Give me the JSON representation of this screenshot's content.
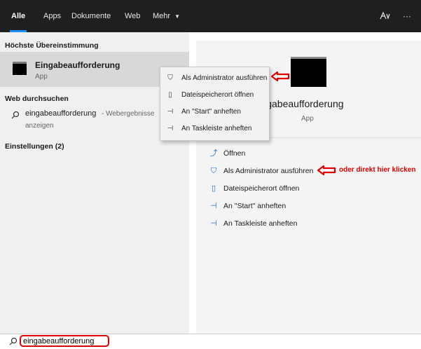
{
  "tabs": [
    {
      "label": "Alle"
    },
    {
      "label": "Apps"
    },
    {
      "label": "Dokumente"
    },
    {
      "label": "Web"
    },
    {
      "label": "Mehr"
    }
  ],
  "top_actions": {
    "more": "···"
  },
  "left": {
    "best_match_header": "Höchste Übereinstimmung",
    "best_match": {
      "title": "Eingabeaufforderung",
      "subtitle": "App"
    },
    "web_header": "Web durchsuchen",
    "web_result": {
      "query": "eingabeaufforderung",
      "suffix": "- Webergebnisse",
      "suffix2": "anzeigen"
    },
    "settings_header": "Einstellungen (2)"
  },
  "right": {
    "app_title": "Eingabeaufforderung",
    "app_subtitle": "App",
    "actions": [
      {
        "label": "Öffnen",
        "icon": "open-icon"
      },
      {
        "label": "Als Administrator ausführen",
        "icon": "admin-shield-icon"
      },
      {
        "label": "Dateispeicherort öffnen",
        "icon": "file-location-icon"
      },
      {
        "label": "An \"Start\" anheften",
        "icon": "pin-icon"
      },
      {
        "label": "An Taskleiste anheften",
        "icon": "pin-icon"
      }
    ]
  },
  "context_menu": [
    {
      "label": "Als Administrator ausführen",
      "icon": "admin-shield-icon"
    },
    {
      "label": "Dateispeicherort öffnen",
      "icon": "file-location-icon"
    },
    {
      "label": "An \"Start\" anheften",
      "icon": "pin-icon"
    },
    {
      "label": "An Taskleiste anheften",
      "icon": "pin-icon"
    }
  ],
  "annotation": {
    "text": "oder direkt hier klicken",
    "color": "#e00000"
  },
  "search": {
    "value": "eingabeaufforderung"
  },
  "colors": {
    "accent": "#1f8fff",
    "highlight": "#e00000",
    "topbar": "#1f1f1f"
  }
}
